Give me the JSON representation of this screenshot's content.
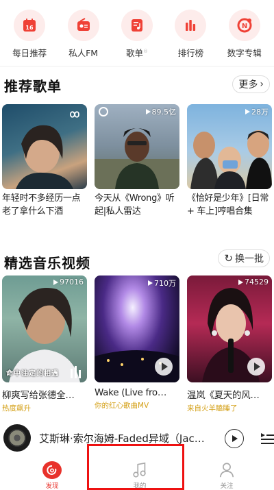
{
  "quick_entries": [
    {
      "label": "每日推荐",
      "icon": "calendar-icon",
      "day": "16"
    },
    {
      "label": "私人FM",
      "icon": "radio-icon"
    },
    {
      "label": "歌单",
      "icon": "playlist-icon"
    },
    {
      "label": "排行榜",
      "icon": "chart-bars-icon"
    },
    {
      "label": "数字专辑",
      "icon": "digital-album-icon"
    }
  ],
  "recommended": {
    "title": "推荐歌单",
    "more_label": "更多",
    "playlists": [
      {
        "title": "年轻时不多经历一点 老了拿什么下酒",
        "count": ""
      },
      {
        "title": "今天从《Wrong》听起|私人雷达",
        "count": "89.5亿"
      },
      {
        "title": "《恰好是少年》[日常 + 车上]哼唱合集",
        "count": "28万"
      }
    ]
  },
  "videos": {
    "title": "精选音乐视频",
    "refresh_label": "换一批",
    "items": [
      {
        "title": "柳爽写给张德全…",
        "views": "97016",
        "tag": "热度飙升",
        "caption": "命中注定的相遇"
      },
      {
        "title": "Wake (Live fro…",
        "views": "710万",
        "tag": "你的红心歌曲MV"
      },
      {
        "title": "温岚《夏天的风…",
        "views": "74529",
        "tag": "来自火羊瞌睡了"
      }
    ]
  },
  "player": {
    "track": "艾斯琳·索尔海姆-Faded异域（Jac…"
  },
  "nav": [
    {
      "label": "发现",
      "active": true
    },
    {
      "label": "我的",
      "active": false
    },
    {
      "label": "关注",
      "active": false
    }
  ],
  "colors": {
    "accent": "#e8322b",
    "highlight_box": "#ee1111",
    "tag": "#d4a017"
  }
}
